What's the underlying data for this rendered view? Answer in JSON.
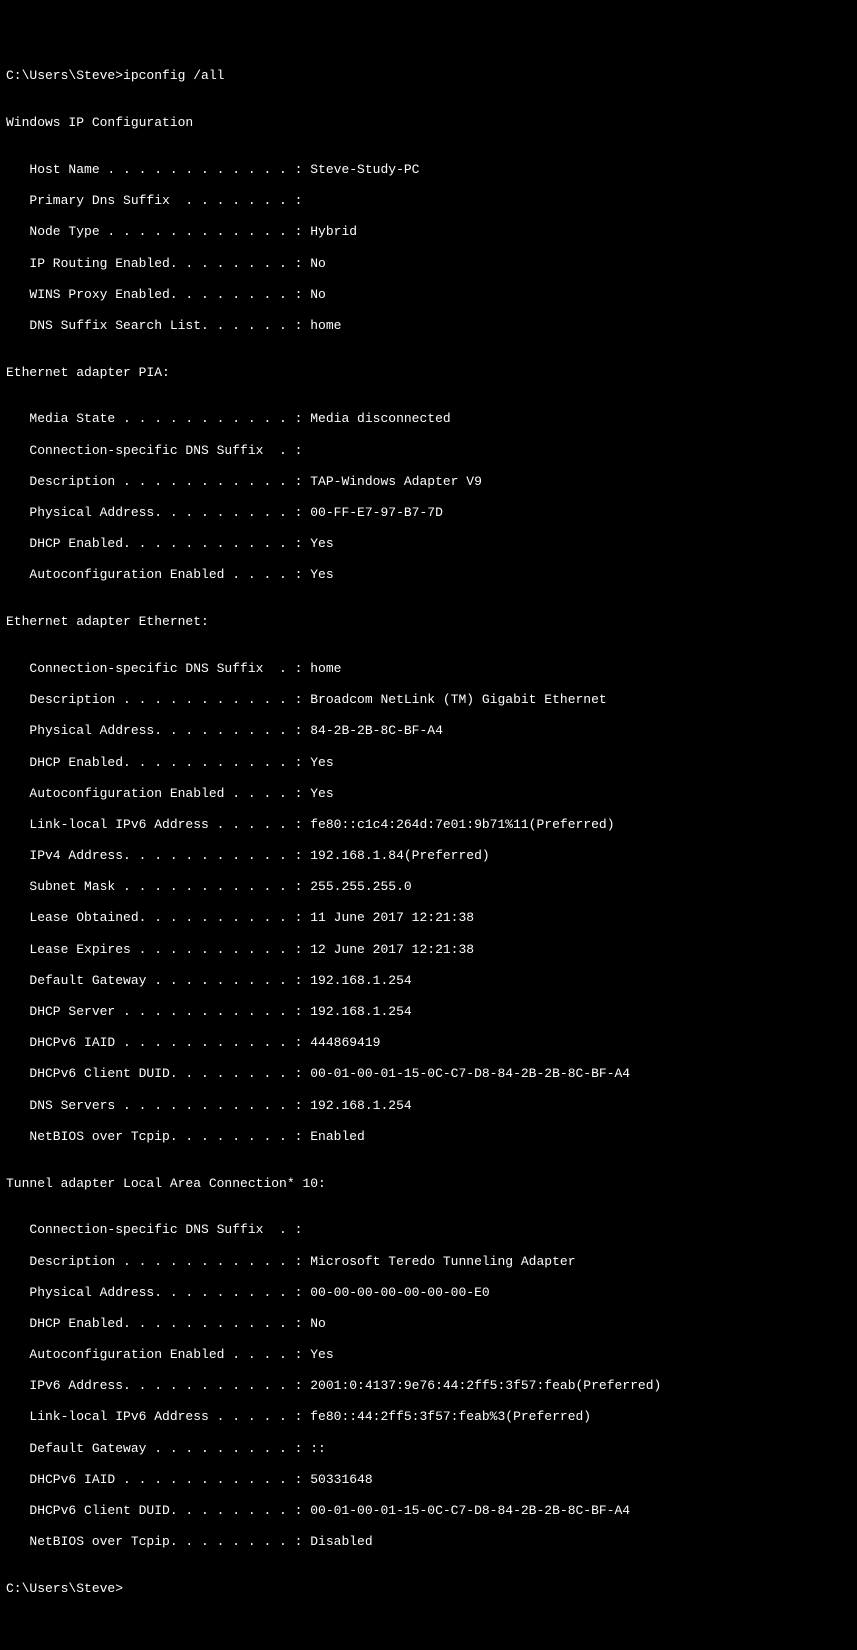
{
  "prompt1": "C:\\Users\\Steve>ipconfig /all",
  "blank": "",
  "header": "Windows IP Configuration",
  "config": {
    "hostName": "   Host Name . . . . . . . . . . . . : Steve-Study-PC",
    "primaryDns": "   Primary Dns Suffix  . . . . . . . :",
    "nodeType": "   Node Type . . . . . . . . . . . . : Hybrid",
    "ipRouting": "   IP Routing Enabled. . . . . . . . : No",
    "winsProxy": "   WINS Proxy Enabled. . . . . . . . : No",
    "dnsSuffix": "   DNS Suffix Search List. . . . . . : home"
  },
  "pia": {
    "header": "Ethernet adapter PIA:",
    "mediaState": "   Media State . . . . . . . . . . . : Media disconnected",
    "connSuffix": "   Connection-specific DNS Suffix  . :",
    "description": "   Description . . . . . . . . . . . : TAP-Windows Adapter V9",
    "physical": "   Physical Address. . . . . . . . . : 00-FF-E7-97-B7-7D",
    "dhcp": "   DHCP Enabled. . . . . . . . . . . : Yes",
    "autoconfig": "   Autoconfiguration Enabled . . . . : Yes"
  },
  "ethernet": {
    "header": "Ethernet adapter Ethernet:",
    "connSuffix": "   Connection-specific DNS Suffix  . : home",
    "description": "   Description . . . . . . . . . . . : Broadcom NetLink (TM) Gigabit Ethernet",
    "physical": "   Physical Address. . . . . . . . . : 84-2B-2B-8C-BF-A4",
    "dhcp": "   DHCP Enabled. . . . . . . . . . . : Yes",
    "autoconfig": "   Autoconfiguration Enabled . . . . : Yes",
    "linkLocal": "   Link-local IPv6 Address . . . . . : fe80::c1c4:264d:7e01:9b71%11(Preferred)",
    "ipv4": "   IPv4 Address. . . . . . . . . . . : 192.168.1.84(Preferred)",
    "subnet": "   Subnet Mask . . . . . . . . . . . : 255.255.255.0",
    "leaseObtained": "   Lease Obtained. . . . . . . . . . : 11 June 2017 12:21:38",
    "leaseExpires": "   Lease Expires . . . . . . . . . . : 12 June 2017 12:21:38",
    "gateway": "   Default Gateway . . . . . . . . . : 192.168.1.254",
    "dhcpServer": "   DHCP Server . . . . . . . . . . . : 192.168.1.254",
    "dhcpv6iaid": "   DHCPv6 IAID . . . . . . . . . . . : 444869419",
    "dhcpv6duid": "   DHCPv6 Client DUID. . . . . . . . : 00-01-00-01-15-0C-C7-D8-84-2B-2B-8C-BF-A4",
    "dnsServers": "   DNS Servers . . . . . . . . . . . : 192.168.1.254",
    "netbios": "   NetBIOS over Tcpip. . . . . . . . : Enabled"
  },
  "tunnel": {
    "header": "Tunnel adapter Local Area Connection* 10:",
    "connSuffix": "   Connection-specific DNS Suffix  . :",
    "description": "   Description . . . . . . . . . . . : Microsoft Teredo Tunneling Adapter",
    "physical": "   Physical Address. . . . . . . . . : 00-00-00-00-00-00-00-E0",
    "dhcp": "   DHCP Enabled. . . . . . . . . . . : No",
    "autoconfig": "   Autoconfiguration Enabled . . . . : Yes",
    "ipv6": "   IPv6 Address. . . . . . . . . . . : 2001:0:4137:9e76:44:2ff5:3f57:feab(Preferred)",
    "linkLocal": "   Link-local IPv6 Address . . . . . : fe80::44:2ff5:3f57:feab%3(Preferred)",
    "gateway": "   Default Gateway . . . . . . . . . : ::",
    "dhcpv6iaid": "   DHCPv6 IAID . . . . . . . . . . . : 50331648",
    "dhcpv6duid": "   DHCPv6 Client DUID. . . . . . . . : 00-01-00-01-15-0C-C7-D8-84-2B-2B-8C-BF-A4",
    "netbios": "   NetBIOS over Tcpip. . . . . . . . : Disabled"
  },
  "prompt2": "C:\\Users\\Steve>"
}
